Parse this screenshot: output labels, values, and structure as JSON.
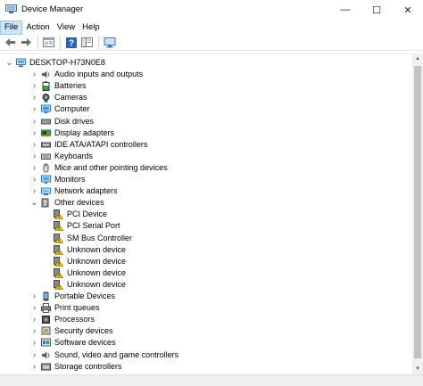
{
  "window": {
    "title": "Device Manager",
    "minimize_glyph": "—",
    "maximize_glyph": "☐",
    "close_glyph": "✕"
  },
  "menu": [
    "File",
    "Action",
    "View",
    "Help"
  ],
  "toolbar": [
    "back-icon",
    "forward-icon",
    "properties-icon",
    "help-icon",
    "show-hide-icon",
    "scan-hardware-icon"
  ],
  "tree": {
    "root": "DESKTOP-H73N0E8",
    "categories": [
      {
        "label": "Audio inputs and outputs",
        "icon": "speaker-icon"
      },
      {
        "label": "Batteries",
        "icon": "battery-icon"
      },
      {
        "label": "Cameras",
        "icon": "camera-icon"
      },
      {
        "label": "Computer",
        "icon": "computer-icon"
      },
      {
        "label": "Disk drives",
        "icon": "disk-drive-icon"
      },
      {
        "label": "Display adapters",
        "icon": "display-adapter-icon"
      },
      {
        "label": "IDE ATA/ATAPI controllers",
        "icon": "ide-controller-icon"
      },
      {
        "label": "Keyboards",
        "icon": "keyboard-icon"
      },
      {
        "label": "Mice and other pointing devices",
        "icon": "mouse-icon"
      },
      {
        "label": "Monitors",
        "icon": "monitor-icon"
      },
      {
        "label": "Network adapters",
        "icon": "network-adapter-icon"
      },
      {
        "label": "Other devices",
        "icon": "other-devices-icon",
        "expanded": true,
        "children": [
          "PCI Device",
          "PCI Serial Port",
          "SM Bus Controller",
          "Unknown device",
          "Unknown device",
          "Unknown device",
          "Unknown device"
        ]
      },
      {
        "label": "Portable Devices",
        "icon": "portable-devices-icon"
      },
      {
        "label": "Print queues",
        "icon": "printer-icon"
      },
      {
        "label": "Processors",
        "icon": "processor-icon"
      },
      {
        "label": "Security devices",
        "icon": "security-device-icon"
      },
      {
        "label": "Software devices",
        "icon": "software-device-icon"
      },
      {
        "label": "Sound, video and game controllers",
        "icon": "sound-controller-icon"
      },
      {
        "label": "Storage controllers",
        "icon": "storage-controller-icon"
      }
    ]
  },
  "colors": {
    "menu_highlight": "#cce4f7",
    "warning_yellow": "#f5c400",
    "icon_blue": "#2b79d0"
  }
}
